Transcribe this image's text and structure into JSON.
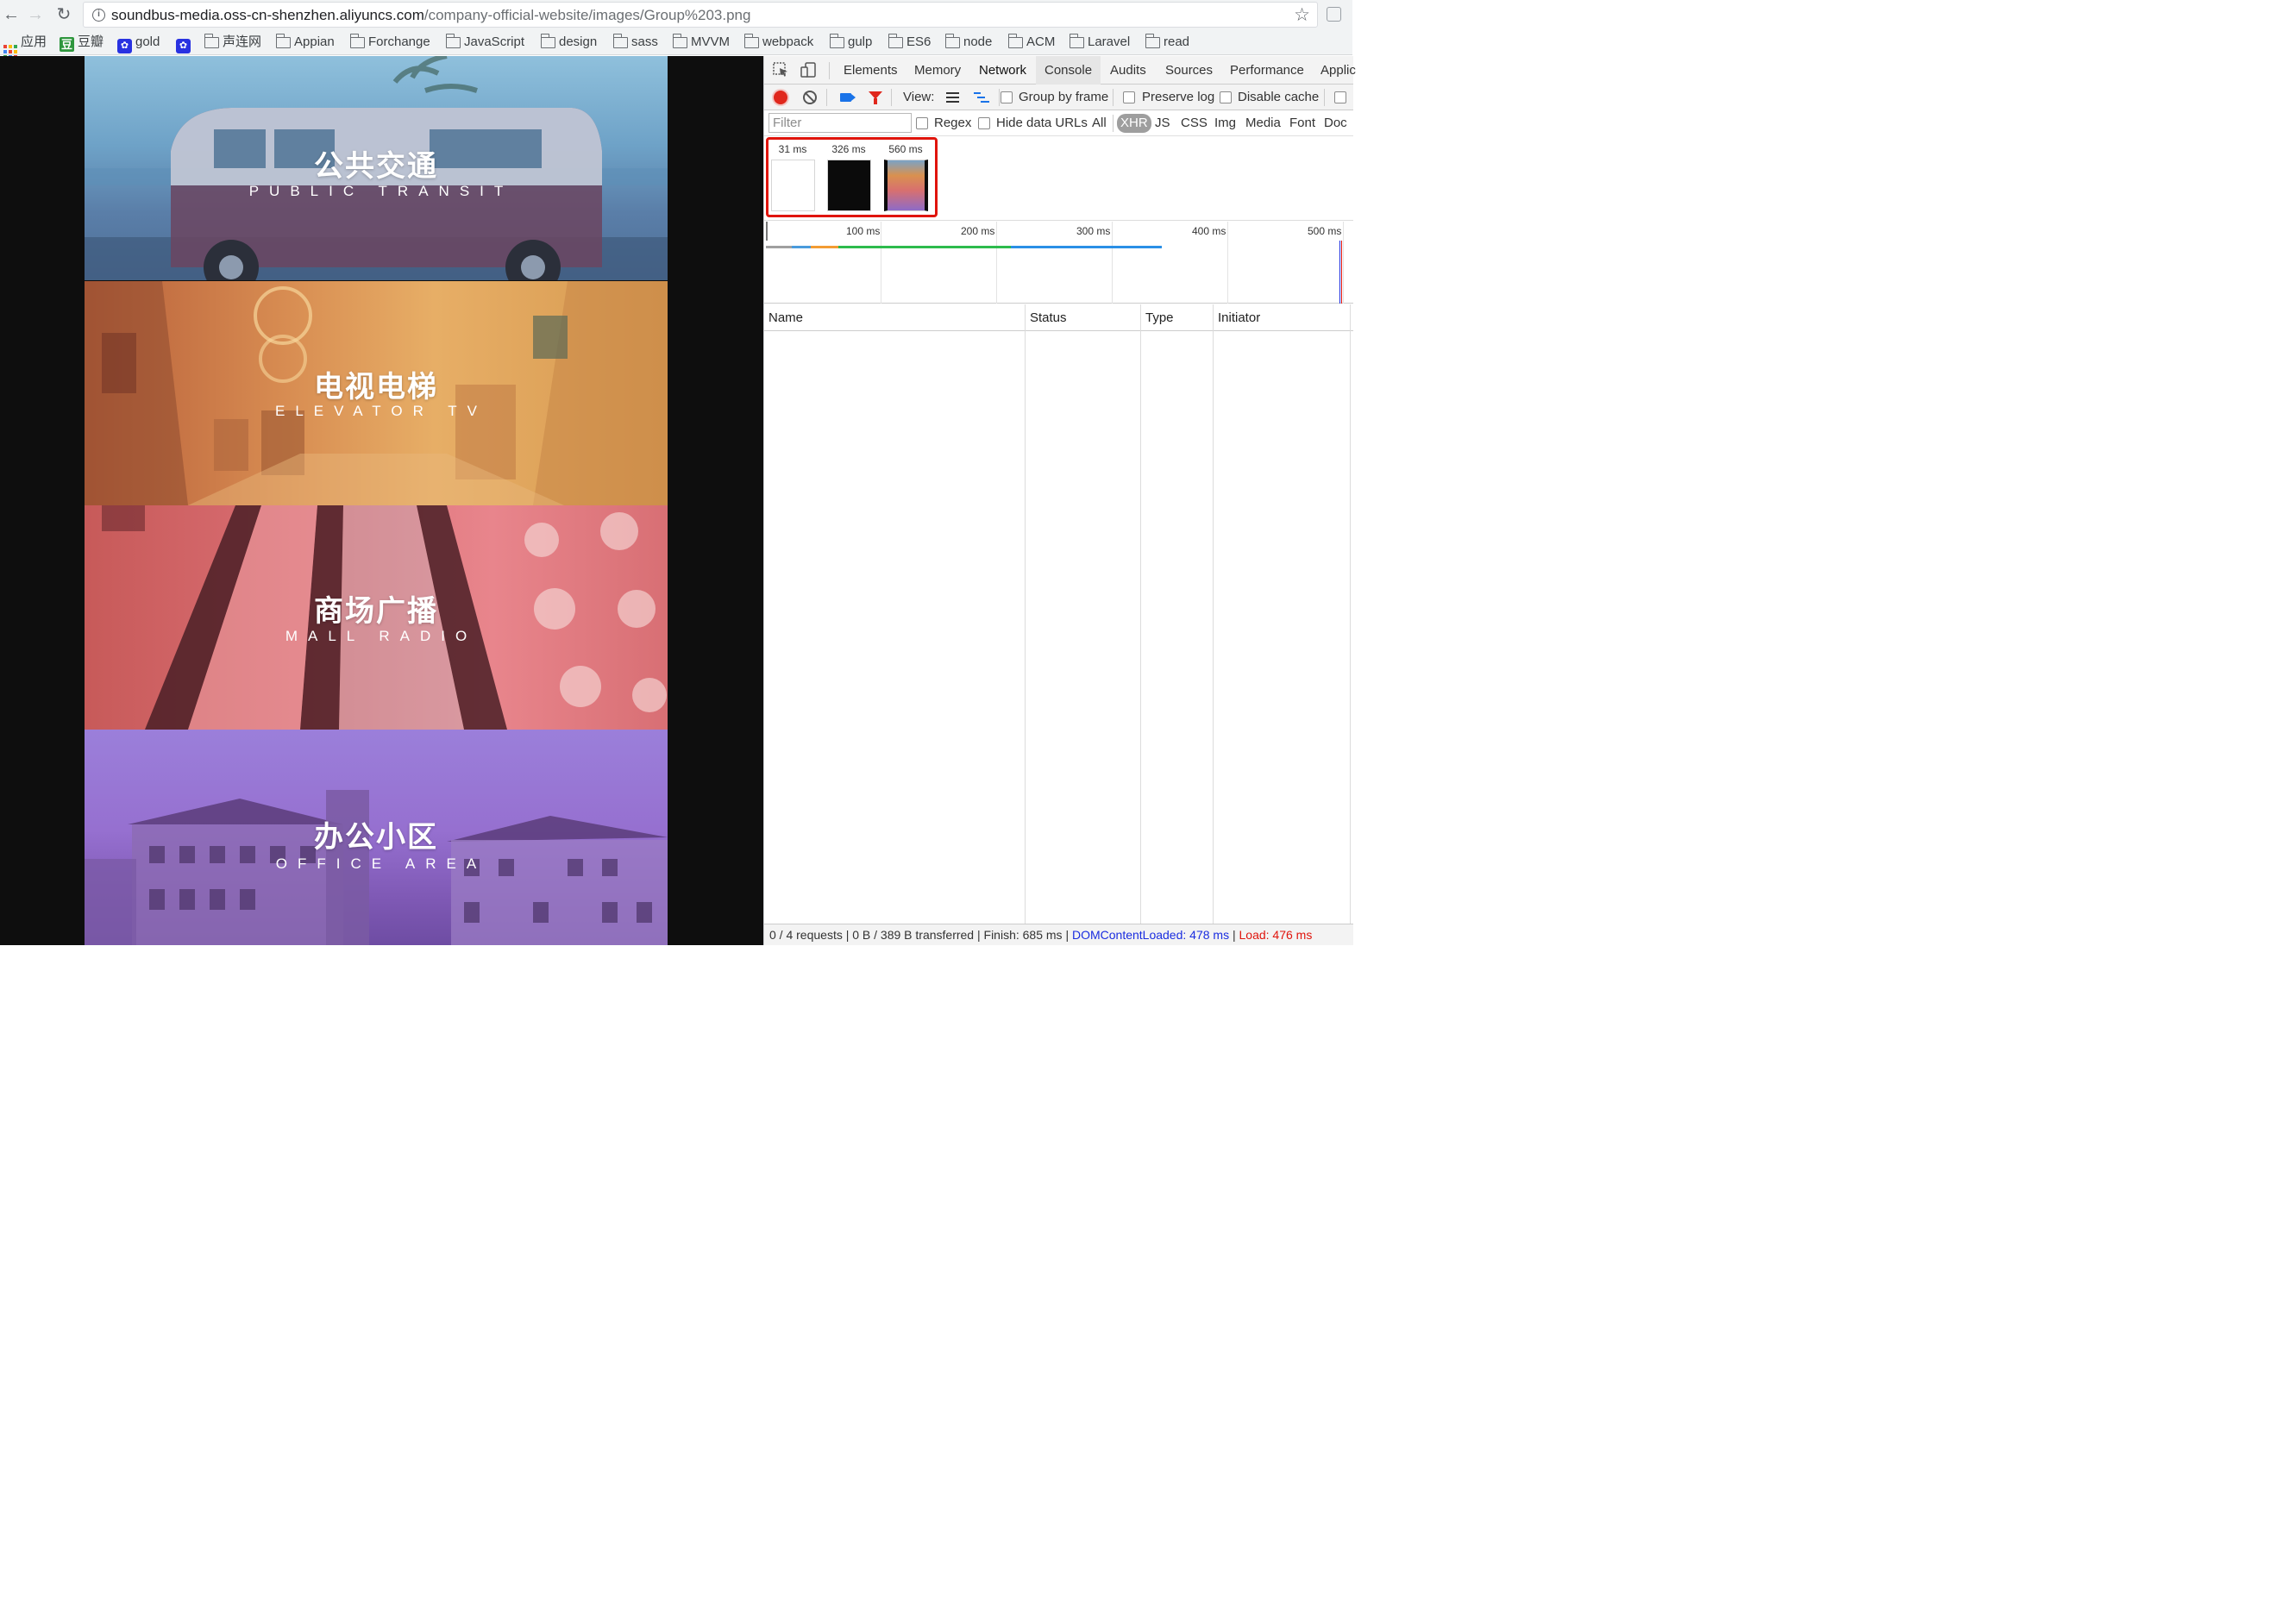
{
  "browser": {
    "url_host": "soundbus-media.oss-cn-shenzhen.aliyuncs.com",
    "url_path": "/company-official-website/images/Group%203.png",
    "back_icon": "←",
    "forward_icon": "→",
    "reload_icon": "↻",
    "star_icon": "☆"
  },
  "bookmarks": [
    {
      "label": "应用",
      "icon": "apps-icon"
    },
    {
      "label": "豆瓣",
      "icon": "douban-icon"
    },
    {
      "label": "gold",
      "icon": "paw-icon"
    },
    {
      "label": "",
      "icon": "paw-icon"
    },
    {
      "label": "声连网",
      "icon": "folder-icon"
    },
    {
      "label": "Appian",
      "icon": "folder-icon"
    },
    {
      "label": "Forchange",
      "icon": "folder-icon"
    },
    {
      "label": "JavaScript",
      "icon": "folder-icon"
    },
    {
      "label": "design",
      "icon": "folder-icon"
    },
    {
      "label": "sass",
      "icon": "folder-icon"
    },
    {
      "label": "MVVM",
      "icon": "folder-icon"
    },
    {
      "label": "webpack",
      "icon": "folder-icon"
    },
    {
      "label": "gulp",
      "icon": "folder-icon"
    },
    {
      "label": "ES6",
      "icon": "folder-icon"
    },
    {
      "label": "node",
      "icon": "folder-icon"
    },
    {
      "label": "ACM",
      "icon": "folder-icon"
    },
    {
      "label": "Laravel",
      "icon": "folder-icon"
    },
    {
      "label": "read",
      "icon": "folder-icon"
    }
  ],
  "page": {
    "panels": [
      {
        "title": "公共交通",
        "subtitle": "PUBLIC TRANSIT"
      },
      {
        "title": "电视电梯",
        "subtitle": "ELEVATOR TV"
      },
      {
        "title": "商场广播",
        "subtitle": "MALL RADIO"
      },
      {
        "title": "办公小区",
        "subtitle": "OFFICE AREA"
      }
    ]
  },
  "devtools": {
    "tabs": [
      "Elements",
      "Memory",
      "Network",
      "Console",
      "Audits",
      "Sources",
      "Performance",
      "Applic"
    ],
    "selected_tab": "Network",
    "view_label": "View:",
    "checkboxes": {
      "group_by_frame": "Group by frame",
      "preserve_log": "Preserve log",
      "disable_cache": "Disable cache",
      "regex": "Regex",
      "hide_data_urls": "Hide data URLs"
    },
    "filter_placeholder": "Filter",
    "type_filters": [
      "All",
      "XHR",
      "JS",
      "CSS",
      "Img",
      "Media",
      "Font",
      "Doc"
    ],
    "active_type_filter": "XHR",
    "filmstrip": [
      {
        "time": "31 ms"
      },
      {
        "time": "326 ms"
      },
      {
        "time": "560 ms"
      }
    ],
    "overview_ticks": [
      "100 ms",
      "200 ms",
      "300 ms",
      "400 ms",
      "500 ms"
    ],
    "columns": [
      "Name",
      "Status",
      "Type",
      "Initiator"
    ],
    "status": {
      "summary": "0 / 4 requests | 0 B / 389 B transferred | Finish: 685 ms | ",
      "dom_content_loaded": "DOMContentLoaded: 478 ms",
      "separator": " | ",
      "load": "Load: 476 ms"
    },
    "colors": {
      "record": "#e0271c",
      "dcl_blue": "#1a2de0",
      "load_red": "#e0140c",
      "highlight": "#e0140c"
    }
  }
}
